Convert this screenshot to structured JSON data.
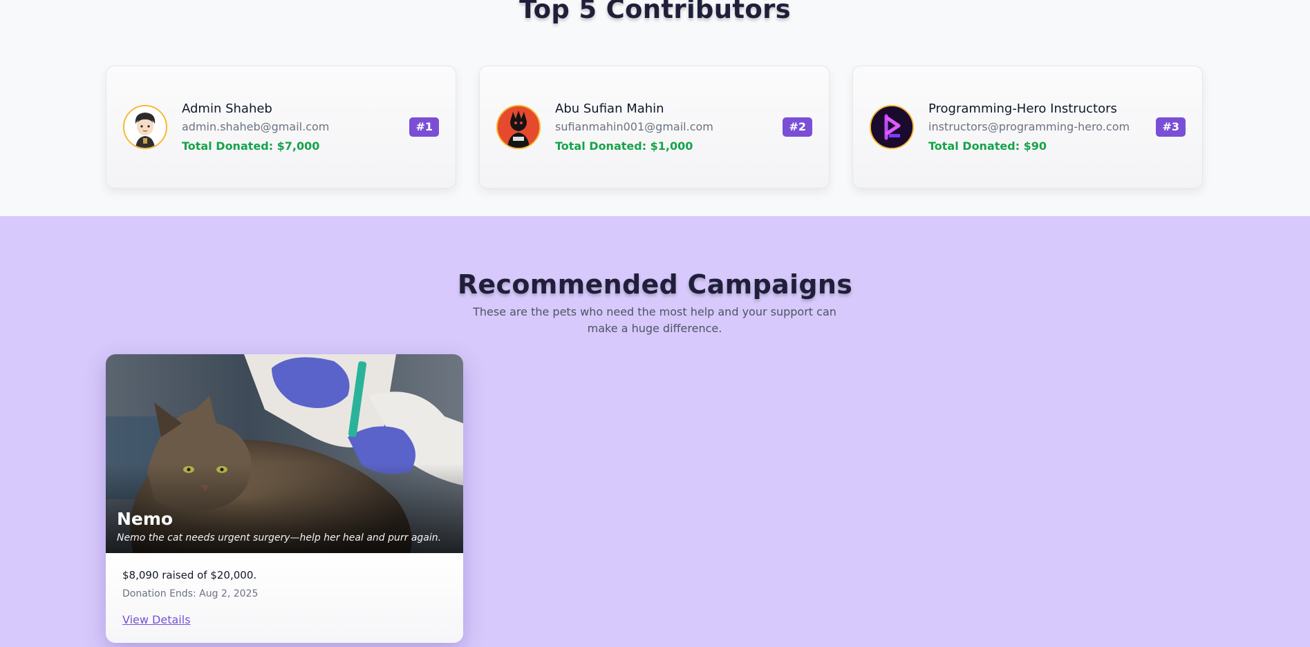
{
  "top_contributors": {
    "title": "Top 5 Contributors",
    "cards": [
      {
        "name": "Admin Shaheb",
        "email": "admin.shaheb@gmail.com",
        "total": "Total Donated: $7,000",
        "rank": "#1",
        "avatar_icon": "cartoon-avatar"
      },
      {
        "name": "Abu Sufian Mahin",
        "email": "sufianmahin001@gmail.com",
        "total": "Total Donated: $1,000",
        "rank": "#2",
        "avatar_icon": "anime-avatar"
      },
      {
        "name": "Programming-Hero Instructors",
        "email": "instructors@programming-hero.com",
        "total": "Total Donated: $90",
        "rank": "#3",
        "avatar_icon": "programming-hero-logo"
      }
    ]
  },
  "recommended": {
    "title": "Recommended Campaigns",
    "subtitle": "These are the pets who need the most help and your support can make a huge difference.",
    "campaigns": [
      {
        "name": "Nemo",
        "description": "Nemo the cat needs urgent surgery—help her heal and purr again.",
        "raised": "$8,090 raised of $20,000.",
        "ends": "Donation Ends: Aug 2, 2025",
        "link_label": "View Details"
      }
    ]
  },
  "colors": {
    "accent": "#7a4fd6",
    "donated_green": "#16a34a",
    "section_purple": "#d7c9fb",
    "avatar_ring": "#f5b82e"
  }
}
